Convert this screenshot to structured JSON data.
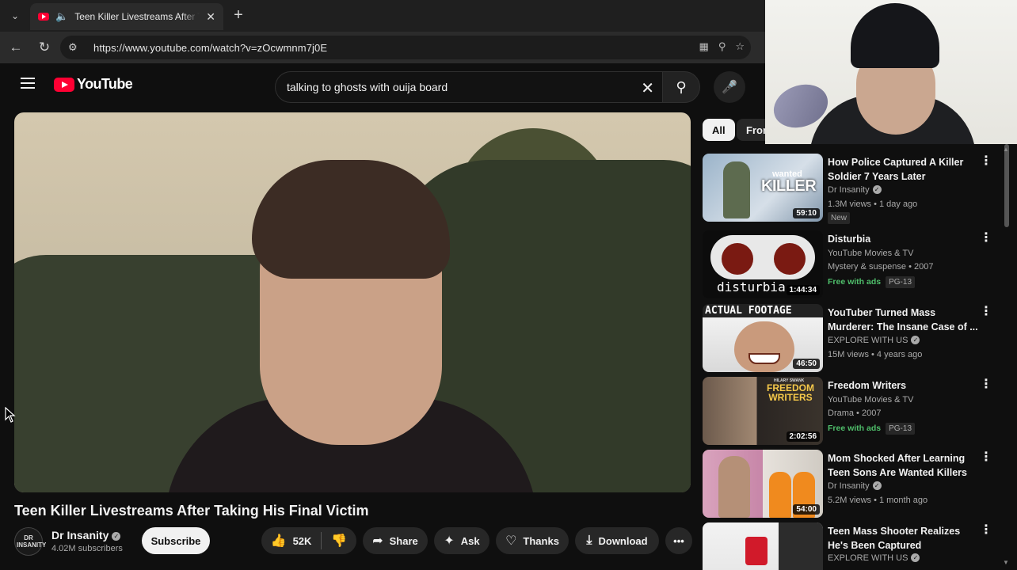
{
  "browser": {
    "tab_title": "Teen Killer Livestreams After Taking His Final Victim",
    "url": "https://www.youtube.com/watch?v=zOcwmnm7j0E"
  },
  "header": {
    "logo_text": "YouTube",
    "search_value": "talking to ghosts with ouija board"
  },
  "video": {
    "title": "Teen Killer Livestreams After Taking His Final Victim",
    "channel": "Dr Insanity",
    "avatar_text": "DR INSANITY",
    "subscribers": "4.02M subscribers",
    "subscribe_label": "Subscribe",
    "likes": "52K",
    "share_label": "Share",
    "ask_label": "Ask",
    "thanks_label": "Thanks",
    "download_label": "Download"
  },
  "chips": [
    "All",
    "From"
  ],
  "recommendations": [
    {
      "title": "How Police Captured A Killer Soldier 7 Years Later",
      "channel": "Dr Insanity",
      "verified": true,
      "meta": "1.3M views • 1 day ago",
      "badge": "New",
      "duration": "59:10",
      "thumb_text": "KILLER",
      "thumb_text2": "wanted"
    },
    {
      "title": "Disturbia",
      "channel": "YouTube Movies & TV",
      "verified": false,
      "meta": "Mystery & suspense • 2007",
      "free": "Free with ads",
      "rating": "PG-13",
      "duration": "1:44:34",
      "thumb_text": "disturbia"
    },
    {
      "title": "YouTuber Turned Mass Murderer: The Insane Case of ...",
      "channel": "EXPLORE WITH US",
      "verified": true,
      "meta": "15M views • 4 years ago",
      "duration": "46:50",
      "thumb_text": "ACTUAL FOOTAGE"
    },
    {
      "title": "Freedom Writers",
      "channel": "YouTube Movies & TV",
      "verified": false,
      "meta": "Drama • 2007",
      "free": "Free with ads",
      "rating": "PG-13",
      "duration": "2:02:56",
      "thumb_text": "FREEDOM WRITERS",
      "thumb_text2": "HILARY SWANK"
    },
    {
      "title": "Mom Shocked After Learning Teen Sons Are Wanted Killers",
      "channel": "Dr Insanity",
      "verified": true,
      "meta": "5.2M views • 1 month ago",
      "duration": "54:00"
    },
    {
      "title": "Teen Mass Shooter Realizes He's Been Captured",
      "channel": "EXPLORE WITH US",
      "verified": true
    }
  ],
  "colors": {
    "brand_red": "#ff0033",
    "free_green": "#4fbf6b",
    "background": "#0f0f0f"
  }
}
